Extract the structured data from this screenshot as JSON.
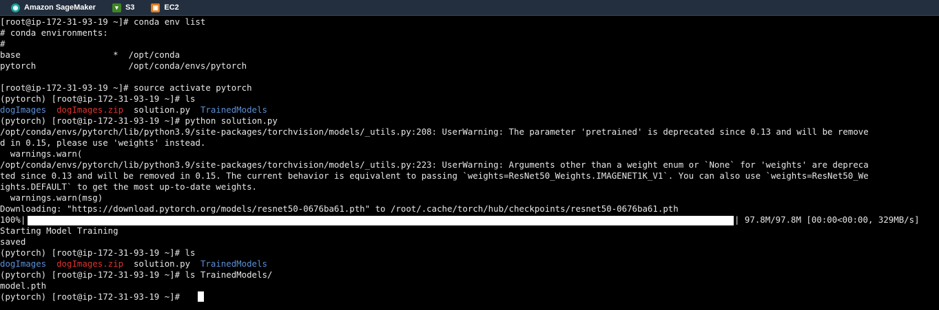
{
  "bookmarks": [
    {
      "label": "Amazon SageMaker",
      "icon": "sagemaker-icon",
      "color": "#1aa19a"
    },
    {
      "label": "S3",
      "icon": "s3-bucket-icon",
      "color": "#3f8624"
    },
    {
      "label": "EC2",
      "icon": "ec2-icon",
      "color": "#e07b1b"
    }
  ],
  "terminal": {
    "lines": {
      "l1": "[root@ip-172-31-93-19 ~]# conda env list",
      "l2": "# conda environments:",
      "l3": "#",
      "l4": "base                  *  /opt/conda",
      "l5": "pytorch                  /opt/conda/envs/pytorch",
      "l7": "[root@ip-172-31-93-19 ~]# source activate pytorch",
      "l8": "(pytorch) [root@ip-172-31-93-19 ~]# ls",
      "l10": "(pytorch) [root@ip-172-31-93-19 ~]# python solution.py",
      "l11": "/opt/conda/envs/pytorch/lib/python3.9/site-packages/torchvision/models/_utils.py:208: UserWarning: The parameter 'pretrained' is deprecated since 0.13 and will be remove",
      "l12": "d in 0.15, please use 'weights' instead.",
      "l13": "  warnings.warn(",
      "l14": "/opt/conda/envs/pytorch/lib/python3.9/site-packages/torchvision/models/_utils.py:223: UserWarning: Arguments other than a weight enum or `None` for 'weights' are depreca",
      "l15": "ted since 0.13 and will be removed in 0.15. The current behavior is equivalent to passing `weights=ResNet50_Weights.IMAGENET1K_V1`. You can also use `weights=ResNet50_We",
      "l16": "ights.DEFAULT` to get the most up-to-date weights.",
      "l17": "  warnings.warn(msg)",
      "l18": "Downloading: \"https://download.pytorch.org/models/resnet50-0676ba61.pth\" to /root/.cache/torch/hub/checkpoints/resnet50-0676ba61.pth",
      "l20": "Starting Model Training",
      "l21": "saved",
      "l22": "(pytorch) [root@ip-172-31-93-19 ~]# ls",
      "l24": "(pytorch) [root@ip-172-31-93-19 ~]# ls TrainedModels/",
      "l25": "model.pth",
      "l26": "(pytorch) [root@ip-172-31-93-19 ~]# "
    },
    "ls_output": {
      "dog_images": "dogImages",
      "dog_images_zip": "dogImages.zip",
      "solution": "solution.py",
      "trained_models": "TrainedModels"
    },
    "progress": {
      "percent_label": "100%|",
      "fraction": 1.0,
      "suffix": "| 97.8M/97.8M [00:00<00:00, 329MB/s]"
    }
  }
}
